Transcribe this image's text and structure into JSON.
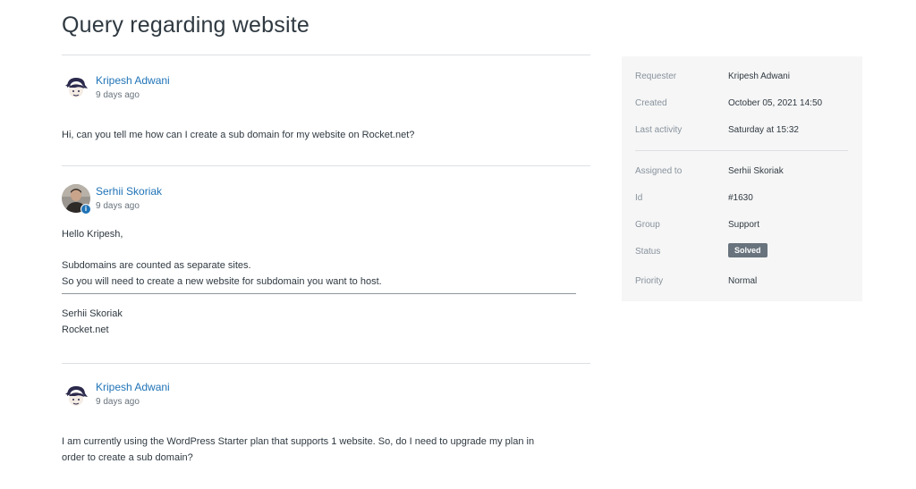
{
  "page": {
    "title": "Query regarding website"
  },
  "comments": [
    {
      "author": "Kripesh Adwani",
      "meta": "9 days ago",
      "body": [
        "Hi, can you tell me how can I create a sub domain for my website on Rocket.net?"
      ]
    },
    {
      "author": "Serhii Skoriak",
      "meta": "9 days ago",
      "body": [
        "Hello Kripesh,",
        "Subdomains are counted as separate sites.",
        "So you will need to create a new website for subdomain you want to host."
      ],
      "signature": [
        "Serhii Skoriak",
        "Rocket.net"
      ]
    },
    {
      "author": "Kripesh Adwani",
      "meta": "9 days ago",
      "body": [
        "I am currently using the WordPress Starter plan that supports 1 website. So, do I need to upgrade my plan in",
        "order to create a sub domain?"
      ]
    }
  ],
  "sidebar": {
    "requester": {
      "label": "Requester",
      "value": "Kripesh Adwani"
    },
    "created": {
      "label": "Created",
      "value": "October 05, 2021 14:50"
    },
    "last_activity": {
      "label": "Last activity",
      "value": "Saturday at 15:32"
    },
    "assigned_to": {
      "label": "Assigned to",
      "value": "Serhii Skoriak"
    },
    "id": {
      "label": "Id",
      "value": "#1630"
    },
    "group": {
      "label": "Group",
      "value": "Support"
    },
    "status": {
      "label": "Status",
      "value": "Solved"
    },
    "priority": {
      "label": "Priority",
      "value": "Normal"
    }
  },
  "colors": {
    "link": "#1f73b7",
    "status_badge": "#68737d",
    "sidebar_bg": "#f6f6f6"
  }
}
